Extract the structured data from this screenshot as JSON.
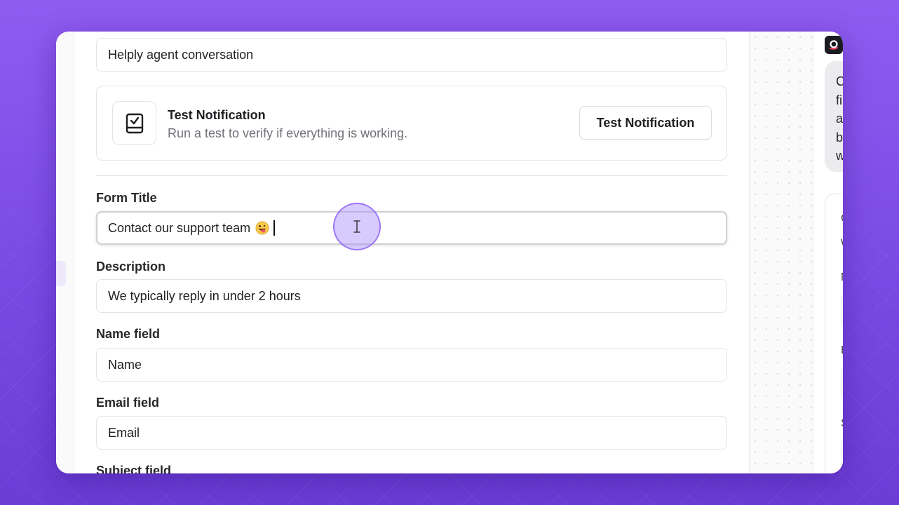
{
  "conversation_title_value": "Helply agent conversation",
  "test_card": {
    "title": "Test Notification",
    "subtitle": "Run a test to verify if everything is working.",
    "button_label": "Test Notification"
  },
  "form": {
    "title_label": "Form Title",
    "title_value": "Contact our support team",
    "description_label": "Description",
    "description_value": "We typically reply in under 2 hours",
    "name_label": "Name field",
    "name_value": "Name",
    "email_label": "Email field",
    "email_value": "Email",
    "subject_label": "Subject field"
  },
  "preview": {
    "bubble_letters": [
      "C",
      "fi",
      "a",
      "b",
      "w"
    ],
    "form_letters": [
      "C",
      "W",
      "N",
      "E",
      "S"
    ]
  },
  "icons": {
    "checklist": "clipboard-check-icon",
    "emoji": "grinning-tongue-emoji",
    "text_cursor": "i-beam-cursor-icon",
    "logo": "helply-logo-icon"
  },
  "colors": {
    "background": "#8f5cf0",
    "cursor_highlight": "#a78bfa",
    "text_primary": "#1f1f23",
    "text_muted": "#71717a"
  }
}
